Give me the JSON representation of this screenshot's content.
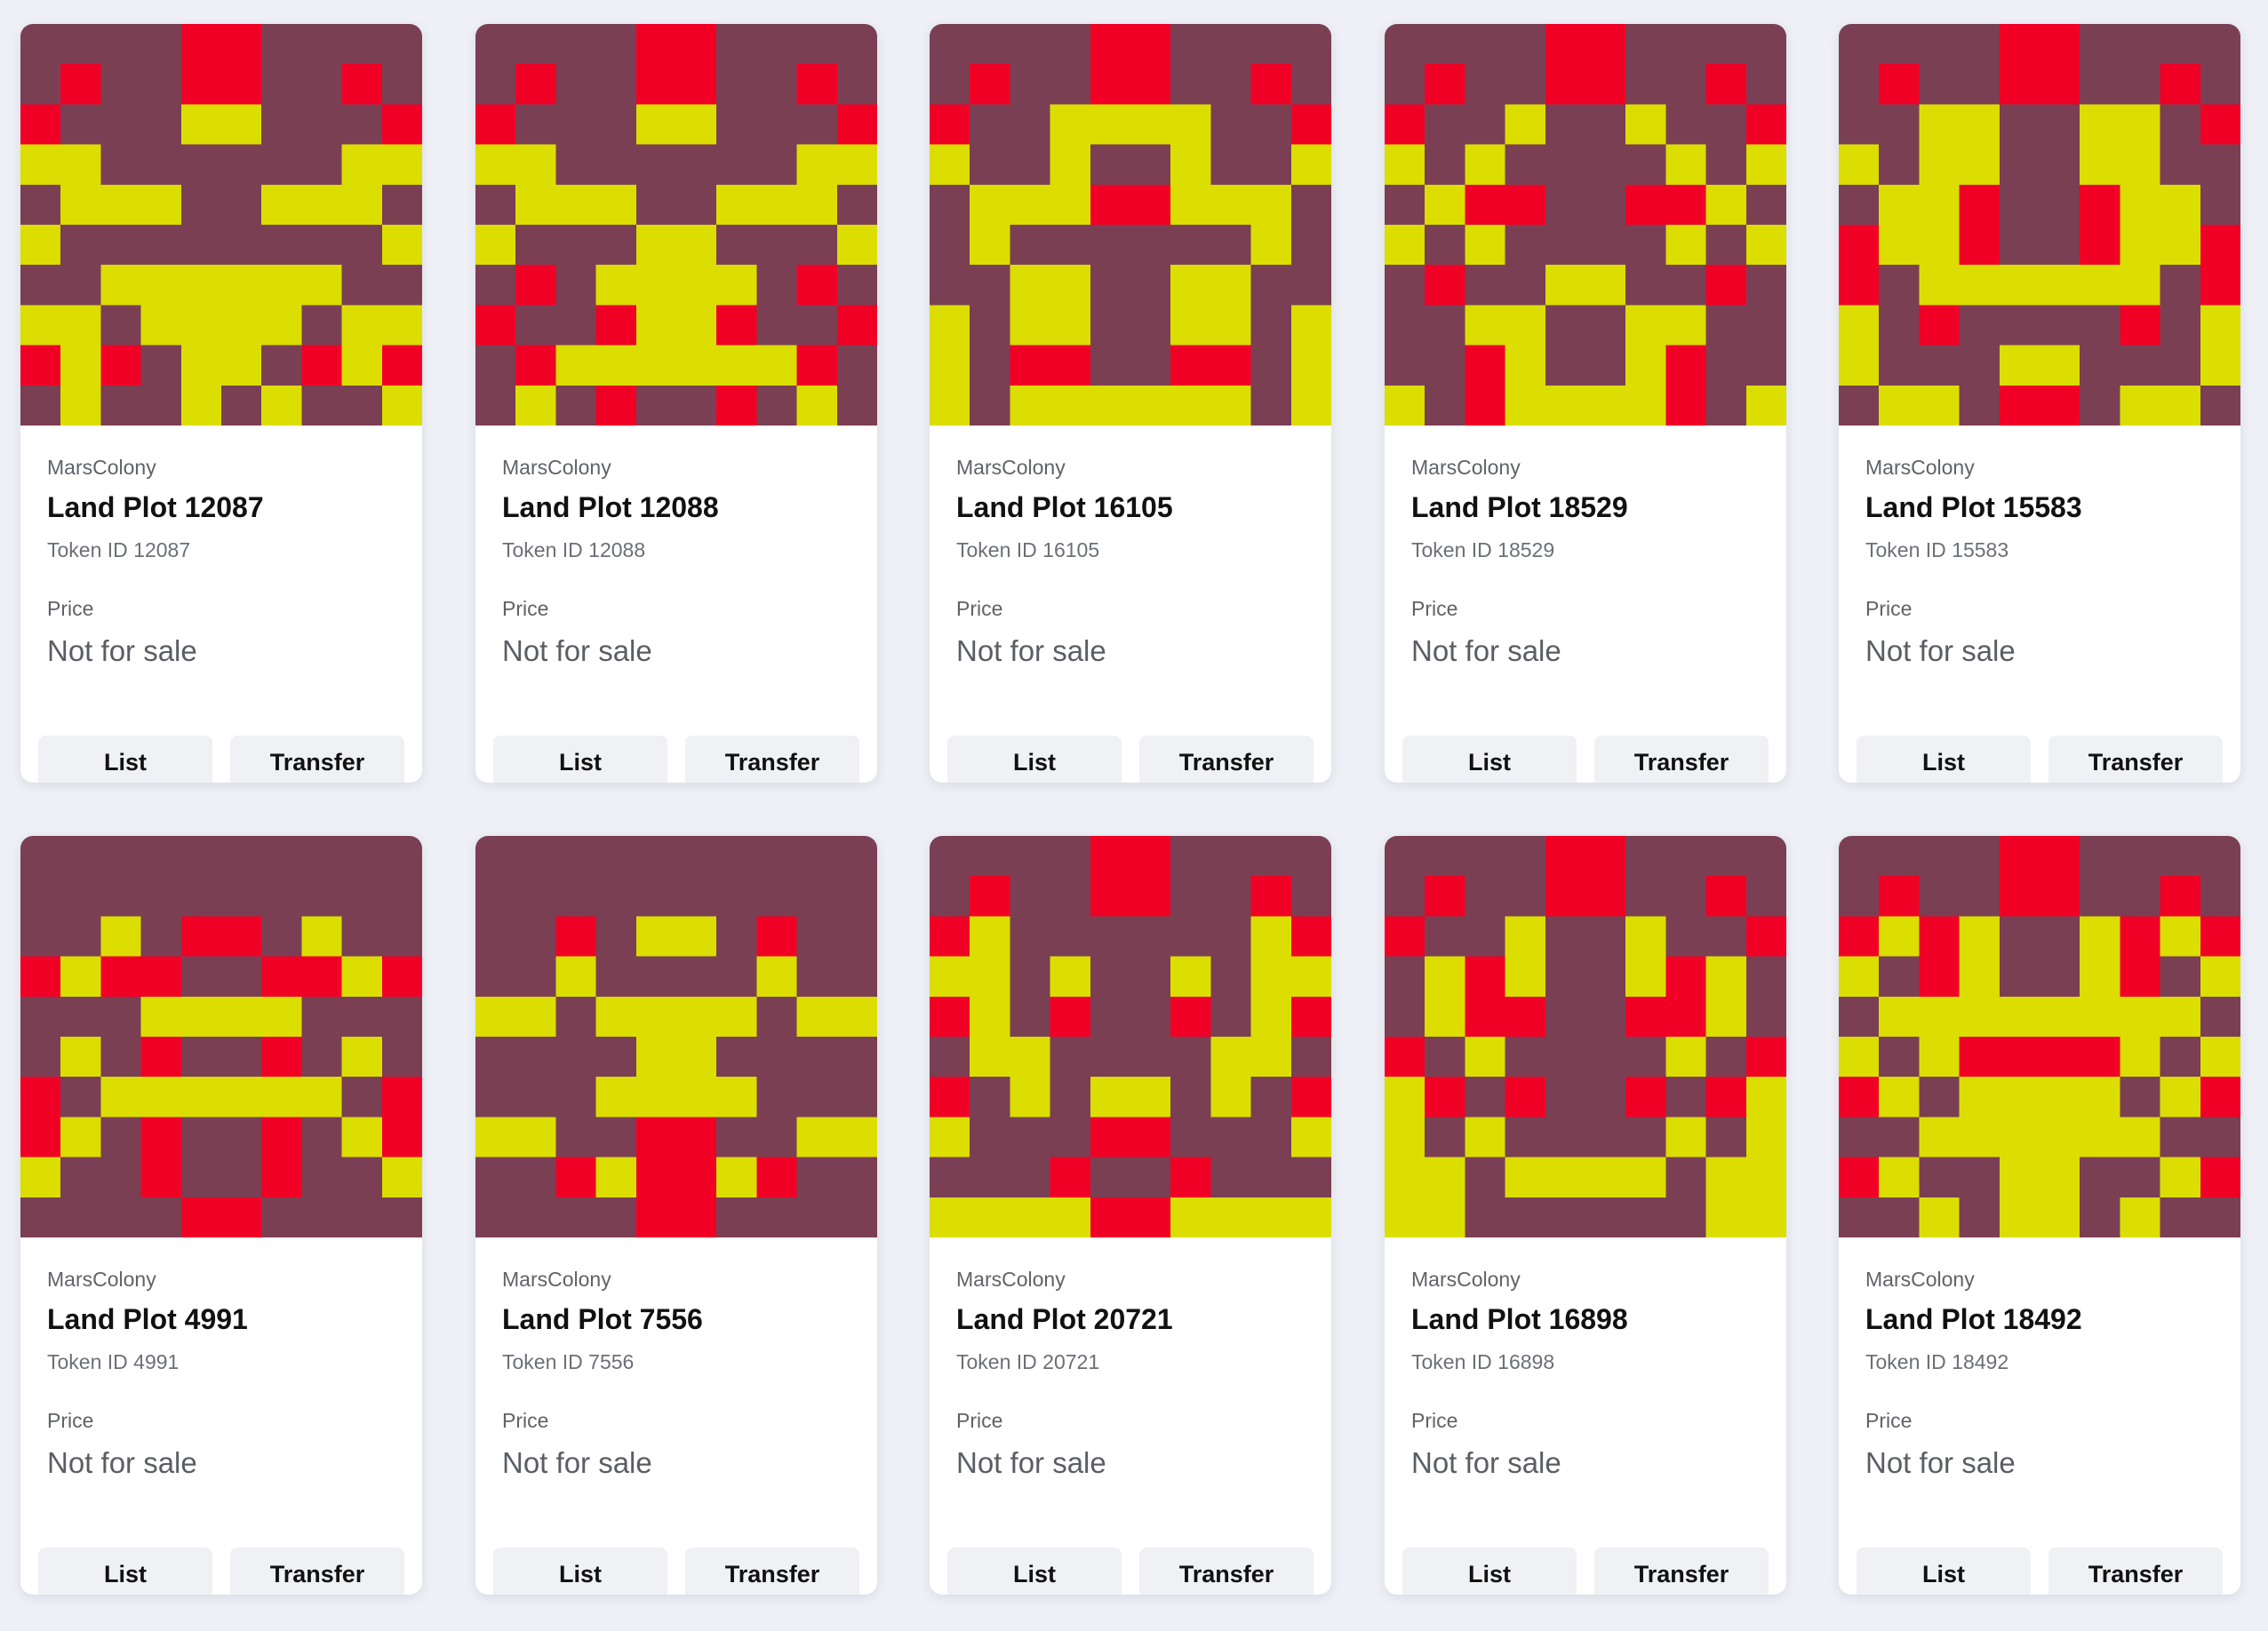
{
  "colors": {
    "maroon": "#7b3f53",
    "red": "#f10026",
    "yellow": "#dbde00",
    "background": "#eef0f6"
  },
  "cards": [
    {
      "collection": "MarsColony",
      "title": "Land Plot 12087",
      "token_id": "Token ID 12087",
      "price_label": "Price",
      "price": "Not for sale",
      "list_label": "List",
      "transfer_label": "Transfer",
      "pixels": [
        "MMMMRRMMMM",
        "MRMMRRMMRM",
        "RMMMYYMMMR",
        "YYMMMMMMYY",
        "MYYYMMYYYM",
        "YMMMMMMMMY",
        "MMYYYYYYMM",
        "YYMYYYYMYY",
        "RYRMYYMRYR",
        "MYMMYMYMMY"
      ]
    },
    {
      "collection": "MarsColony",
      "title": "Land Plot 12088",
      "token_id": "Token ID 12088",
      "price_label": "Price",
      "price": "Not for sale",
      "list_label": "List",
      "transfer_label": "Transfer",
      "pixels": [
        "MMMMRRMMMM",
        "MRMMRRMMRM",
        "RMMMYYMMMR",
        "YYMMMMMMYY",
        "MYYYMMYYYM",
        "YMMMYYMMMY",
        "MRMYYYYMRM",
        "RMMRYYRMMR",
        "MRYYYYYYRM",
        "MYMRMMRMYM"
      ]
    },
    {
      "collection": "MarsColony",
      "title": "Land Plot 16105",
      "token_id": "Token ID 16105",
      "price_label": "Price",
      "price": "Not for sale",
      "list_label": "List",
      "transfer_label": "Transfer",
      "pixels": [
        "MMMMRRMMMM",
        "MRMMRRMMRM",
        "RMMYYYYMMR",
        "YMMYMMYMMY",
        "MYYYRRYYYM",
        "MYMMMMMMYM",
        "MMYYMMYYMM",
        "YMYYMMYYMY",
        "YMRRMMRRMY",
        "YMYYYYYYMY"
      ]
    },
    {
      "collection": "MarsColony",
      "title": "Land Plot 18529",
      "token_id": "Token ID 18529",
      "price_label": "Price",
      "price": "Not for sale",
      "list_label": "List",
      "transfer_label": "Transfer",
      "pixels": [
        "MMMMRRMMMM",
        "MRMMRRMMRM",
        "RMMYMMYMMR",
        "YMYMMMMYMY",
        "MYRRMMRRYM",
        "YMYMMMMYMY",
        "MRMMYYMMRM",
        "MMYYMMYYMM",
        "MMRYMMYRMM",
        "YMRYYYYRMY"
      ]
    },
    {
      "collection": "MarsColony",
      "title": "Land Plot 15583",
      "token_id": "Token ID 15583",
      "price_label": "Price",
      "price": "Not for sale",
      "list_label": "List",
      "transfer_label": "Transfer",
      "pixels": [
        "MMMMRRMMMM",
        "MRMMRRMMRM",
        "MMYYMMYYMR",
        "YMYYMMYYMM",
        "MYYRMMRYYM",
        "RYYRMMRYYR",
        "RMYYYYYYMR",
        "YMRMMMMRMY",
        "YMMMYYMMMY",
        "MYYMRRMYYM"
      ]
    },
    {
      "collection": "MarsColony",
      "title": "Land Plot 4991",
      "token_id": "Token ID 4991",
      "price_label": "Price",
      "price": "Not for sale",
      "list_label": "List",
      "transfer_label": "Transfer",
      "pixels": [
        "MMMMMMMMMM",
        "MMMMMMMMMM",
        "MMYMRRMYMM",
        "RYRRMMRRYR",
        "MMMYYYYMMM",
        "MYMRMMRMYM",
        "RMYYYYYYMR",
        "RYMRMMRMYR",
        "YMMRMMRMMY",
        "MMMMRRMMMM"
      ]
    },
    {
      "collection": "MarsColony",
      "title": "Land Plot 7556",
      "token_id": "Token ID 7556",
      "price_label": "Price",
      "price": "Not for sale",
      "list_label": "List",
      "transfer_label": "Transfer",
      "pixels": [
        "MMMMMMMMMM",
        "MMMMMMMMMM",
        "MMRMYYMRMM",
        "MMYMMMMYMM",
        "YYMYYYYMYY",
        "MMMMYYMMMM",
        "MMMYYYYMMM",
        "YYMMRRMMYY",
        "MMRYRRYRMM",
        "MMMMRRMMMM"
      ]
    },
    {
      "collection": "MarsColony",
      "title": "Land Plot 20721",
      "token_id": "Token ID 20721",
      "price_label": "Price",
      "price": "Not for sale",
      "list_label": "List",
      "transfer_label": "Transfer",
      "pixels": [
        "MMMMRRMMMM",
        "MRMMRRMMRM",
        "RYMMMMMMYR",
        "YYMYMMYMYY",
        "RYMRMMRMYR",
        "MYYMMMMYYM",
        "RMYMYYMYMR",
        "YMMMRRMMMY",
        "MMMRMMRMMM",
        "YYYYRRYYYY"
      ]
    },
    {
      "collection": "MarsColony",
      "title": "Land Plot 16898",
      "token_id": "Token ID 16898",
      "price_label": "Price",
      "price": "Not for sale",
      "list_label": "List",
      "transfer_label": "Transfer",
      "pixels": [
        "MMMMRRMMMM",
        "MRMMRRMMRM",
        "RMMYMMYMMR",
        "MYRYMMYRYM",
        "MYRRMMRRYM",
        "RMYMMMMYMR",
        "YRMRMMRMRY",
        "YMYMMMMYMY",
        "YYMYYYYMYY",
        "YYMMMMMMYY"
      ]
    },
    {
      "collection": "MarsColony",
      "title": "Land Plot 18492",
      "token_id": "Token ID 18492",
      "price_label": "Price",
      "price": "Not for sale",
      "list_label": "List",
      "transfer_label": "Transfer",
      "pixels": [
        "MMMMRRMMMM",
        "MRMMRRMMRM",
        "RYRYMMYRYR",
        "YMRYMMYRMY",
        "MYYYYYYYYM",
        "YMYRRRRYMY",
        "RYMYYYYMYR",
        "MMYYYYYYMM",
        "RYMMYYMMYR",
        "MMYMYYMYMM"
      ]
    }
  ]
}
